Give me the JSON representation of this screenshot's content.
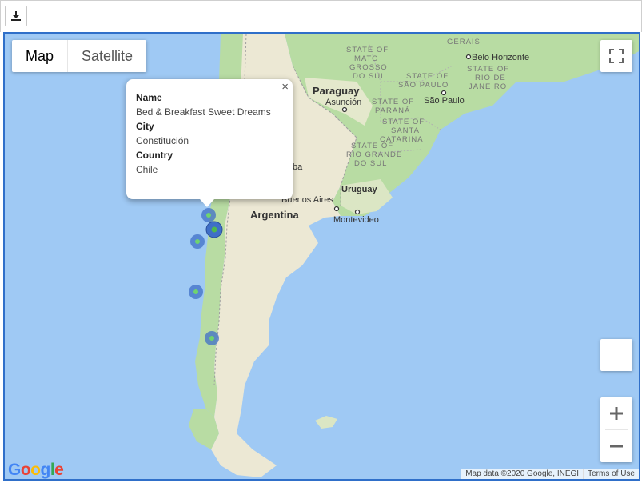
{
  "toolbar": {
    "download_icon": "download-icon"
  },
  "map": {
    "type_controls": {
      "map_label": "Map",
      "satellite_label": "Satellite",
      "selected": "Map"
    },
    "fullscreen_icon": "fullscreen-icon",
    "zoom": {
      "in_label": "+",
      "out_label": "−"
    },
    "places": {
      "paraguay": "Paraguay",
      "asuncion": "Asunción",
      "argentina": "Argentina",
      "uruguay": "Uruguay",
      "montevideo": "Montevideo",
      "buenos_aires": "Buenos Aires",
      "cordoba_partial": "ba",
      "belo_horizonte": "Belo Horizonte",
      "sao_paulo": "São Paulo",
      "gerais": "GERAIS",
      "mato_grosso_do_sul": [
        "STATE OF",
        "MATO",
        "GROSSO",
        "DO SUL"
      ],
      "state_sao_paulo": [
        "STATE OF",
        "SÃO PAULO"
      ],
      "state_rio": [
        "STATE OF",
        "RIO DE",
        "JANEIRO"
      ],
      "state_parana": [
        "STATE OF",
        "PARANÁ"
      ],
      "state_santa_catarina": [
        "STATE OF",
        "SANTA",
        "CATARINA"
      ],
      "state_rio_grande": [
        "STATE OF",
        "RIO GRANDE",
        "DO SUL"
      ]
    },
    "markers": [
      {
        "lat": -33.33,
        "lng": -71.6
      },
      {
        "lat": -35.33,
        "lng": -72.41,
        "selected": true
      },
      {
        "lat": -37.5,
        "lng": -73.5
      },
      {
        "lat": -41.5,
        "lng": -73.8
      },
      {
        "lat": -45.5,
        "lng": -72.6
      }
    ],
    "infowindow": {
      "name_label": "Name",
      "name_value": "Bed & Breakfast Sweet Dreams",
      "city_label": "City",
      "city_value": "Constitución",
      "country_label": "Country",
      "country_value": "Chile",
      "close_label": "×"
    },
    "google_logo": "Google",
    "attribution": "Map data ©2020 Google, INEGI",
    "terms": "Terms of Use",
    "colors": {
      "ocean": "#9fc9f4",
      "land_green": "#b8dca3",
      "land_tan": "#ece8d4",
      "marker": "#3f6fc7",
      "frame_border": "#2f6fc9"
    }
  }
}
